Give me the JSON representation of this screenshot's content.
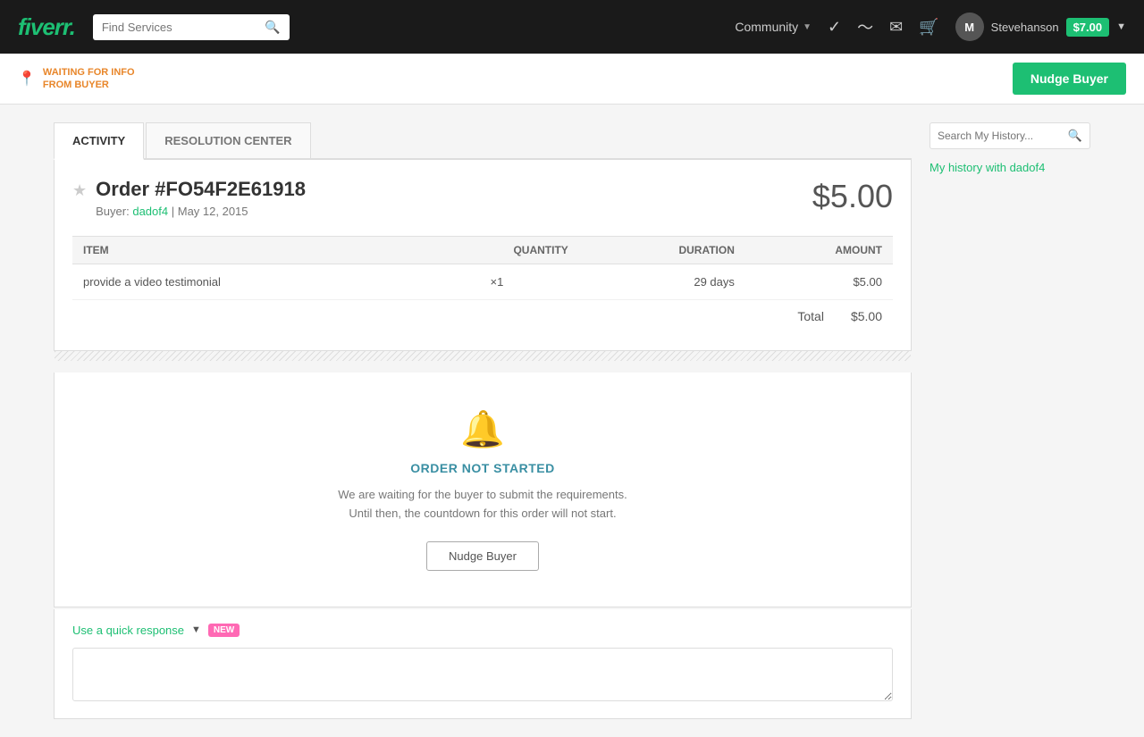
{
  "header": {
    "logo": "fiverr",
    "search_placeholder": "Find Services",
    "community_label": "Community",
    "username": "Stevehanson",
    "user_initial": "M",
    "balance": "$7.00"
  },
  "status_bar": {
    "status_line1": "WAITING FOR INFO",
    "status_line2": "FROM BUYER",
    "nudge_button": "Nudge Buyer"
  },
  "tabs": [
    {
      "label": "ACTIVITY",
      "active": true
    },
    {
      "label": "RESOLUTION CENTER",
      "active": false
    }
  ],
  "order": {
    "title": "Order #FO54F2E61918",
    "buyer_label": "Buyer:",
    "buyer_name": "dadof4",
    "date": "May 12, 2015",
    "price": "$5.00",
    "table": {
      "columns": [
        "ITEM",
        "QUANTITY",
        "DURATION",
        "AMOUNT"
      ],
      "rows": [
        {
          "item": "provide a video testimonial",
          "quantity": "×1",
          "duration": "29 days",
          "amount": "$5.00"
        }
      ]
    },
    "total_label": "Total",
    "total_amount": "$5.00"
  },
  "order_status": {
    "status_title": "ORDER NOT STARTED",
    "description_line1": "We are waiting for the buyer to submit the requirements.",
    "description_line2": "Until then, the countdown for this order will not start.",
    "nudge_button": "Nudge Buyer"
  },
  "quick_response": {
    "link_label": "Use a quick response",
    "new_badge": "NEW",
    "input_placeholder": ""
  },
  "sidebar": {
    "search_placeholder": "Search My History...",
    "history_link": "My history with dadof4"
  }
}
